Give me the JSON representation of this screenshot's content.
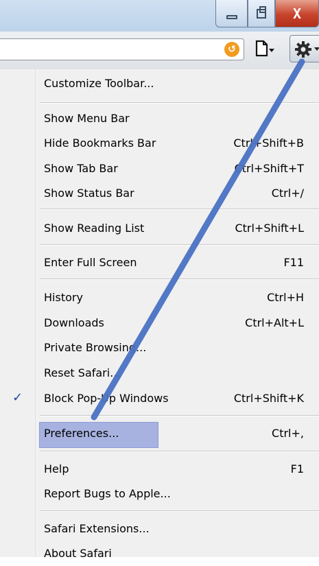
{
  "window": {
    "minimize_icon": "minimize-icon",
    "maximize_icon": "maximize-icon",
    "close_icon": "close-icon",
    "close_glyph": "X"
  },
  "toolbar": {
    "reload_icon": "reload-icon",
    "reload_glyph": "↺",
    "page_menu_icon": "page-menu-icon",
    "settings_icon": "gear-icon"
  },
  "menu": {
    "items": [
      {
        "label": "Customize Toolbar...",
        "shortcut": ""
      },
      {
        "label": "Show Menu Bar",
        "shortcut": ""
      },
      {
        "label": "Hide Bookmarks Bar",
        "shortcut": "Ctrl+Shift+B"
      },
      {
        "label": "Show Tab Bar",
        "shortcut": "Ctrl+Shift+T"
      },
      {
        "label": "Show Status Bar",
        "shortcut": "Ctrl+/"
      },
      {
        "label": "Show Reading List",
        "shortcut": "Ctrl+Shift+L"
      },
      {
        "label": "Enter Full Screen",
        "shortcut": "F11"
      },
      {
        "label": "History",
        "shortcut": "Ctrl+H"
      },
      {
        "label": "Downloads",
        "shortcut": "Ctrl+Alt+L"
      },
      {
        "label": "Private Browsing...",
        "shortcut": ""
      },
      {
        "label": "Reset Safari...",
        "shortcut": ""
      },
      {
        "label": "Block Pop-Up Windows",
        "shortcut": "Ctrl+Shift+K",
        "checked": true
      },
      {
        "label": "Preferences...",
        "shortcut": "Ctrl+,",
        "highlighted": true
      },
      {
        "label": "Help",
        "shortcut": "F1"
      },
      {
        "label": "Report Bugs to Apple...",
        "shortcut": ""
      },
      {
        "label": "Safari Extensions...",
        "shortcut": ""
      },
      {
        "label": "About Safari",
        "shortcut": ""
      }
    ],
    "check_glyph": "✓"
  },
  "colors": {
    "highlight": "#a7b2e0",
    "annotation_arrow": "#4a72c4",
    "check": "#22449a"
  }
}
